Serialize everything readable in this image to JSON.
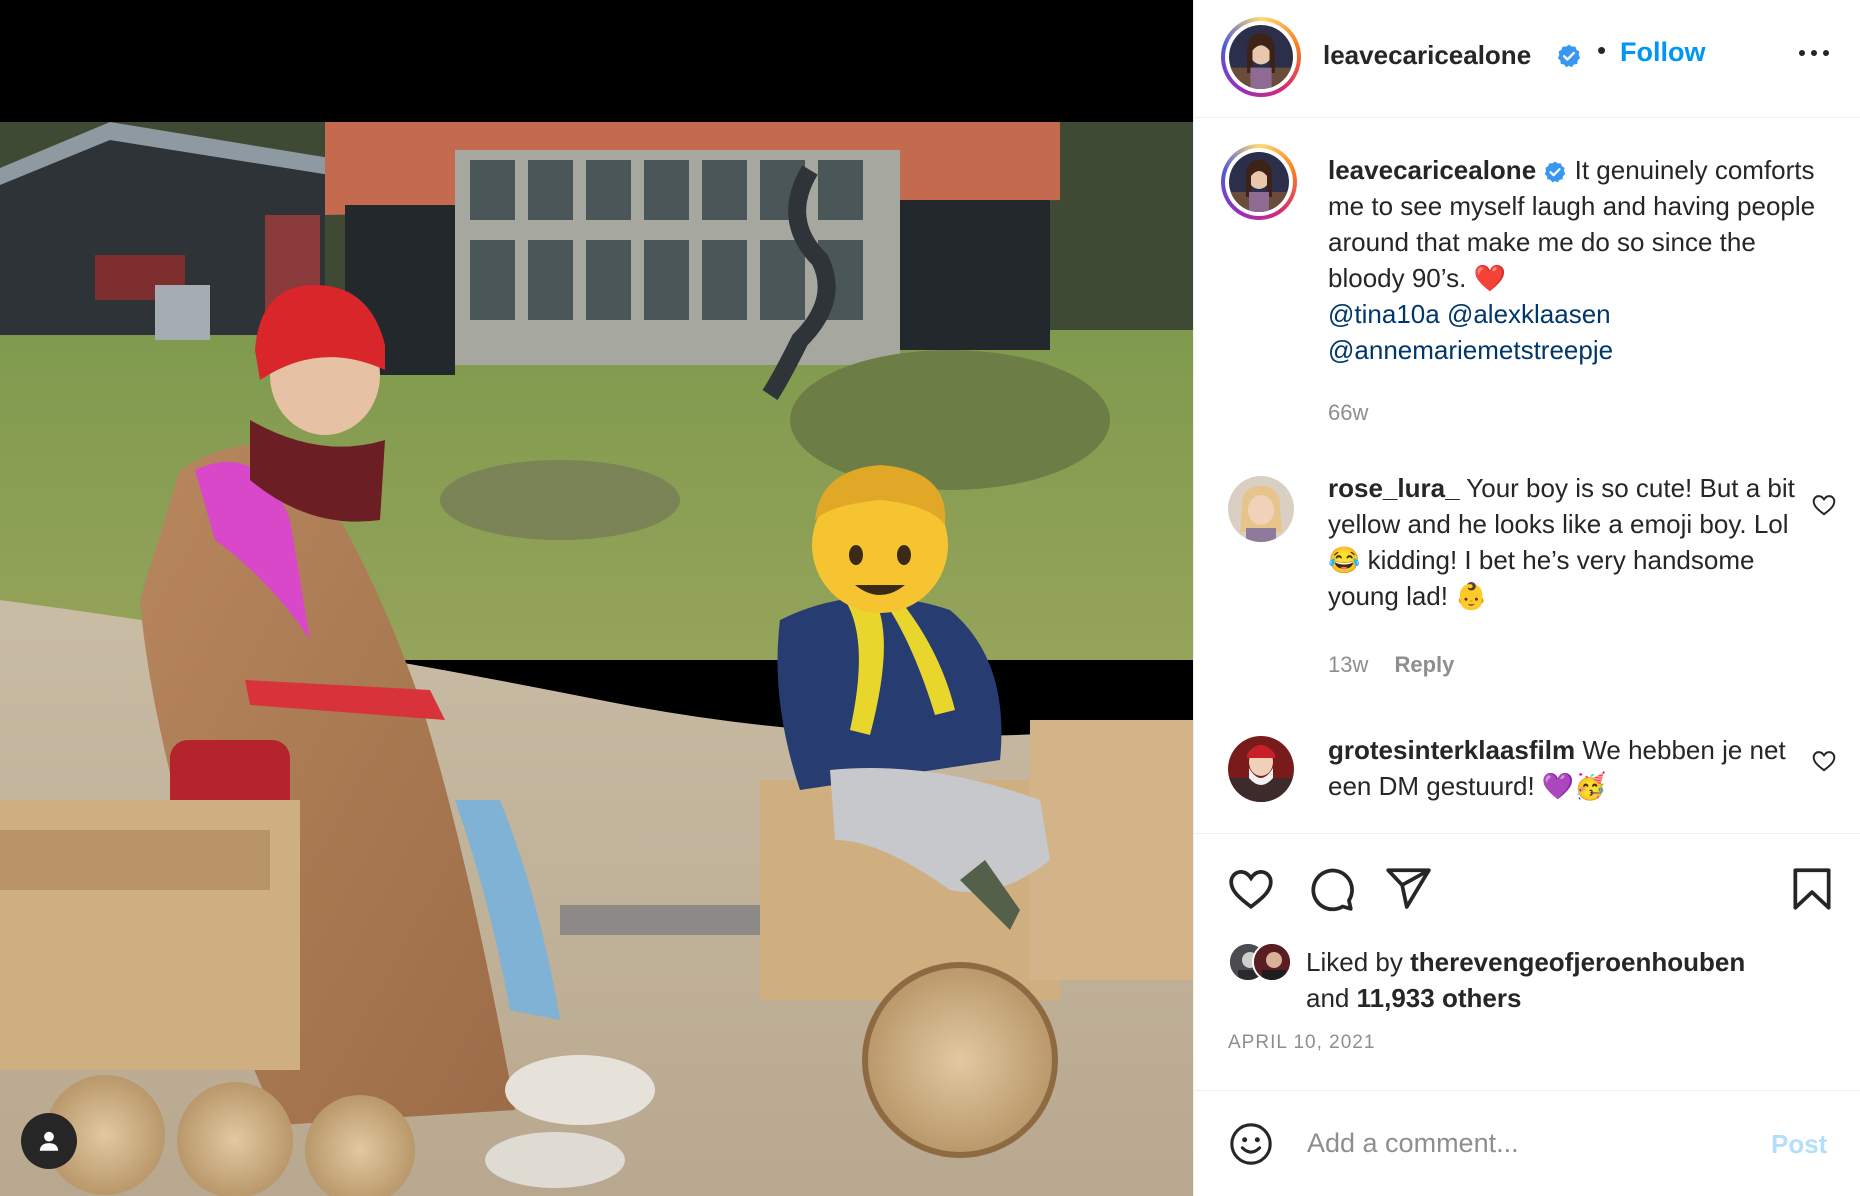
{
  "post": {
    "author": {
      "username": "leavecaricealone",
      "verified": true,
      "follow_label": "Follow",
      "separator": "•"
    },
    "caption": {
      "username": "leavecaricealone",
      "text": "It genuinely comforts me to see myself laugh and having people around that make me do so since the bloody 90’s. ❤️",
      "mentions": [
        "@tina10a",
        "@alexklaasen",
        "@annemariemetstreepje"
      ],
      "time": "66w"
    },
    "comments": [
      {
        "username": "rose_lura_",
        "text": "Your boy is so cute! But a bit yellow and he looks like a emoji boy. Lol😂 kidding! I bet he’s very handsome young lad! 👶",
        "time": "13w",
        "reply_label": "Reply"
      },
      {
        "username": "grotesinterklaasfilm",
        "text": "We hebben je net een DM gestuurd! 💜🥳"
      }
    ],
    "likes": {
      "prefix": "Liked by",
      "user": "therevengeofjeroenhouben",
      "middle": "and",
      "count": "11,933 others"
    },
    "date": "APRIL 10, 2021",
    "comment_box": {
      "placeholder": "Add a comment...",
      "post_label": "Post"
    }
  },
  "icons": {
    "tag": "user-tag-icon",
    "more": "more-options-icon",
    "verified": "verified-badge-icon",
    "like": "heart-icon",
    "comment": "comment-icon",
    "share": "share-icon",
    "save": "bookmark-icon",
    "emoji": "emoji-icon"
  },
  "colors": {
    "accent": "#0095f6",
    "mention": "#00376b",
    "muted": "#8e8e8e",
    "post_disabled": "#b2dffc"
  }
}
